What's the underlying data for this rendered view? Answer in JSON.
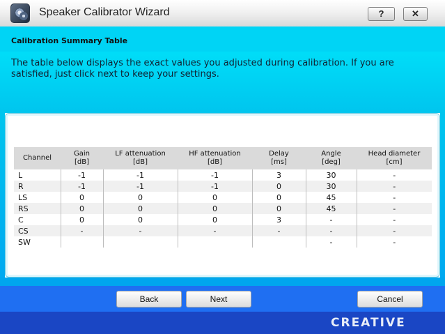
{
  "window": {
    "title": "Speaker Calibrator Wizard",
    "help_label": "?",
    "close_label": "✕"
  },
  "section": {
    "title": "Calibration Summary Table",
    "description": "The table below displays the exact values you adjusted during calibration.  If you are satisfied, just click next to keep your settings."
  },
  "table": {
    "headers": [
      [
        "Channel",
        ""
      ],
      [
        "Gain",
        "[dB]"
      ],
      [
        "LF attenuation",
        "[dB]"
      ],
      [
        "HF attenuation",
        "[dB]"
      ],
      [
        "Delay",
        "[ms]"
      ],
      [
        "Angle",
        "[deg]"
      ],
      [
        "Head diameter",
        "[cm]"
      ]
    ],
    "rows": [
      [
        "L",
        "-1",
        "-1",
        "-1",
        "3",
        "30",
        "-"
      ],
      [
        "R",
        "-1",
        "-1",
        "-1",
        "0",
        "30",
        "-"
      ],
      [
        "LS",
        "0",
        "0",
        "0",
        "0",
        "45",
        "-"
      ],
      [
        "RS",
        "0",
        "0",
        "0",
        "0",
        "45",
        "-"
      ],
      [
        "C",
        "0",
        "0",
        "0",
        "3",
        "-",
        "-"
      ],
      [
        "CS",
        "-",
        "-",
        "-",
        "-",
        "-",
        "-"
      ],
      [
        "SW",
        "",
        "",
        "",
        "",
        "-",
        "-"
      ]
    ]
  },
  "buttons": {
    "back": "Back",
    "next": "Next",
    "cancel": "Cancel"
  },
  "brand": {
    "logo": "CREATIVE"
  },
  "icons": {
    "app": "speaker-icon"
  }
}
